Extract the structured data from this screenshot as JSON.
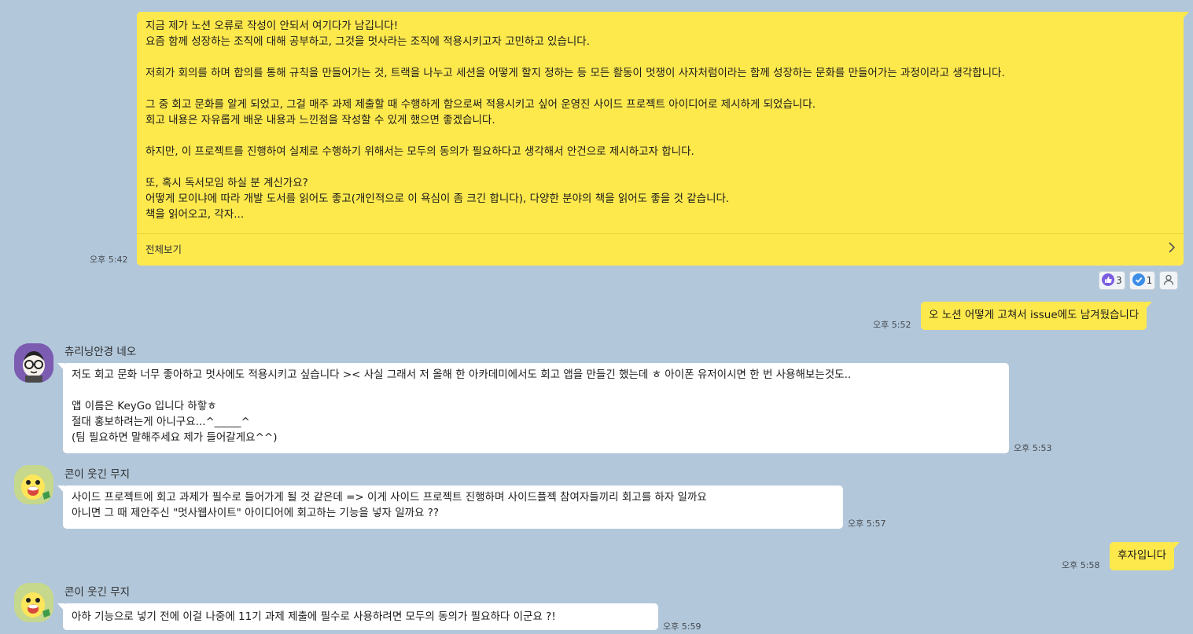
{
  "messages": {
    "m1": {
      "lines": [
        "지금 제가 노션 오류로 작성이 안되서 여기다가 남깁니다!",
        "요즘 함께 성장하는 조직에 대해 공부하고, 그것을 멋사라는 조직에 적용시키고자 고민하고 있습니다.",
        "",
        "저희가 회의를 하며 합의를 통해 규칙을 만들어가는 것, 트랙을 나누고 세션을 어떻게 할지 정하는 등 모든 활동이 멋쟁이 사자처럼이라는 함께 성장하는 문화를 만들어가는 과정이라고 생각합니다.",
        "",
        "그 중 회고 문화를 알게 되었고, 그걸 매주 과제 제출할 때 수행하게 함으로써 적용시키고 싶어 운영진 사이드 프로젝트 아이디어로 제시하게 되었습니다.",
        "회고 내용은 자유롭게 배운 내용과 느낀점을 작성할 수 있게 했으면 좋겠습니다.",
        "",
        "하지만, 이 프로젝트를 진행하여 실제로 수행하기 위해서는 모두의 동의가 필요하다고 생각해서 안건으로 제시하고자 합니다.",
        "",
        "또, 혹시 독서모임 하실 분 계신가요?",
        "어떻게 모이냐에 따라 개발 도서를 읽어도 좋고(개인적으로 이 욕심이 좀 크긴 합니다), 다양한 분야의 책을 읽어도 좋을 것 같습니다.",
        "책을 읽어오고, 각자..."
      ],
      "see_all": "전체보기",
      "time": "오후 5:42",
      "reactions": [
        {
          "icon": "thumbs-up-icon",
          "count": "3"
        },
        {
          "icon": "check-icon",
          "count": "1"
        },
        {
          "icon": "person-icon",
          "count": ""
        }
      ]
    },
    "m2": {
      "text": "오 노션 어떻게 고쳐서 issue에도 남겨뒀습니다",
      "time": "오후 5:52"
    },
    "m3": {
      "sender": "츄리닝안경 네오",
      "lines": [
        "저도 회고 문화 너무 좋아하고 멋사에도 적용시키고 싶습니다 >< 사실 그래서 저 올해 한 아카데미에서도 회고 앱을 만들긴 했는데 ㅎ 아이폰 유저이시면 한 번 사용해보는것도..",
        "",
        "앱 이름은 KeyGo 입니다 하핳ㅎ",
        "절대 홍보하려는게 아니구요...^_____^",
        "(팀 필요하면 말해주세요 제가 들어갈게요^^)"
      ],
      "time": "오후 5:53"
    },
    "m4": {
      "sender": "콘이 웃긴 무지",
      "lines": [
        "사이드 프로젝트에 회고 과제가 필수로 들어가게 될 것 같은데 => 이게 사이드 프로젝트 진행하며 사이드플젝 참여자들끼리 회고를 하자 일까요",
        "아니면 그 때 제안주신 \"멋사웹사이트\" 아이디어에 회고하는 기능을 넣자 일까요 ??"
      ],
      "time": "오후 5:57"
    },
    "m5": {
      "text": "후자입니다",
      "time": "오후 5:58"
    },
    "m6": {
      "sender": "콘이 웃긴 무지",
      "text": "아하 기능으로 넣기 전에 이걸 나중에 11기 과제 제출에 필수로 사용하려면 모두의 동의가 필요하다 이군요 ?!",
      "time": "오후 5:59"
    }
  },
  "colors": {
    "background": "#b2c7da",
    "my_bubble": "#fee94d",
    "other_bubble": "#ffffff",
    "reaction_like": "#7b5de0",
    "reaction_check": "#3c8de8"
  }
}
